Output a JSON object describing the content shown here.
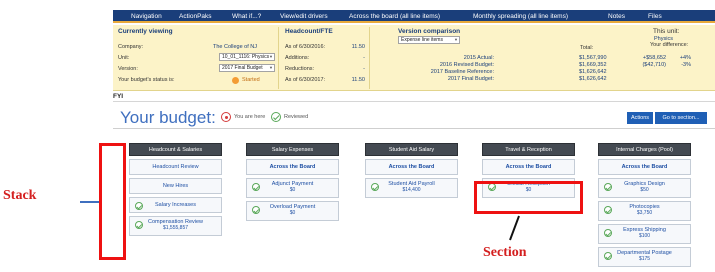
{
  "nav": [
    "Navigation",
    "ActionPaks",
    "What if...?",
    "View/edit drivers",
    "Across the board (all line items)",
    "Monthly spreading (all line items)",
    "Notes",
    "Files"
  ],
  "currently_viewing": {
    "title": "Currently viewing",
    "company_label": "Company:",
    "company_value": "The College of NJ",
    "unit_label": "Unit:",
    "unit_value": "10_01_1116: Physics",
    "version_label": "Version:",
    "version_value": "2017 Final Budget",
    "status_label": "Your budget's status is:",
    "status_value": "Started"
  },
  "headcount": {
    "title": "Headcount/FTE",
    "rows": [
      {
        "label": "As of 6/30/2016:",
        "value": "11.50"
      },
      {
        "label": "Additions:",
        "value": "-"
      },
      {
        "label": "Reductions:",
        "value": "-"
      },
      {
        "label": "As of 6/30/2017:",
        "value": "11.50"
      }
    ]
  },
  "version_comparison": {
    "title": "Version comparison",
    "select_value": "Expense line items",
    "rows": [
      "2015 Actual:",
      "2016 Revised Budget:",
      "2017 Baseline Reference:",
      "2017 Final Budget:"
    ]
  },
  "this_unit": {
    "title": "This unit:",
    "subtitle": "Physics",
    "total_label": "Total:",
    "diff_label": "Your difference:",
    "totals": [
      "$1,567,990",
      "$1,669,352",
      "$1,626,642",
      "$1,626,642"
    ],
    "diffs": [
      "+$58,652",
      "($42,710)",
      "",
      ""
    ],
    "pcts": [
      "+4%",
      "-3%",
      "",
      ""
    ]
  },
  "fyi": "FYI",
  "budget": {
    "title": "Your budget:",
    "legend_here": "You are here",
    "legend_reviewed": "Reviewed",
    "actions": "Actions",
    "goto": "Go to section..."
  },
  "stacks": [
    {
      "title": "Headcount & Salaries",
      "cards": [
        {
          "label": "Headcount Review",
          "amount": "",
          "reviewed": false,
          "bold": false
        },
        {
          "label": "New Hires",
          "amount": "",
          "reviewed": false,
          "bold": false
        },
        {
          "label": "Salary Increases",
          "amount": "",
          "reviewed": true,
          "bold": false
        },
        {
          "label": "Compensation Review",
          "amount": "$1,555,857",
          "reviewed": true,
          "bold": false
        }
      ]
    },
    {
      "title": "Salary Expenses",
      "cards": [
        {
          "label": "Across the Board",
          "amount": "",
          "reviewed": false,
          "bold": true
        },
        {
          "label": "Adjunct Payment",
          "amount": "$0",
          "reviewed": true,
          "bold": false
        },
        {
          "label": "Overload Payment",
          "amount": "$0",
          "reviewed": true,
          "bold": false
        }
      ]
    },
    {
      "title": "Student Aid Salary",
      "cards": [
        {
          "label": "Across the Board",
          "amount": "",
          "reviewed": false,
          "bold": true
        },
        {
          "label": "Student Aid Payroll",
          "amount": "$14,400",
          "reviewed": true,
          "bold": false
        }
      ]
    },
    {
      "title": "Travel & Reception",
      "cards": [
        {
          "label": "Across the Board",
          "amount": "",
          "reviewed": false,
          "bold": true
        },
        {
          "label": "Official Reception",
          "amount": "$0",
          "reviewed": true,
          "bold": false
        }
      ]
    },
    {
      "title": "Internal Charges (Pool)",
      "cards": [
        {
          "label": "Across the Board",
          "amount": "",
          "reviewed": false,
          "bold": true
        },
        {
          "label": "Graphics Design",
          "amount": "$50",
          "reviewed": true,
          "bold": false
        },
        {
          "label": "Photocopies",
          "amount": "$3,750",
          "reviewed": true,
          "bold": false
        },
        {
          "label": "Express Shipping",
          "amount": "$100",
          "reviewed": true,
          "bold": false
        },
        {
          "label": "Departmental Postage",
          "amount": "$175",
          "reviewed": true,
          "bold": false
        }
      ]
    }
  ],
  "annotations": {
    "stack": "Stack",
    "section": "Section"
  }
}
